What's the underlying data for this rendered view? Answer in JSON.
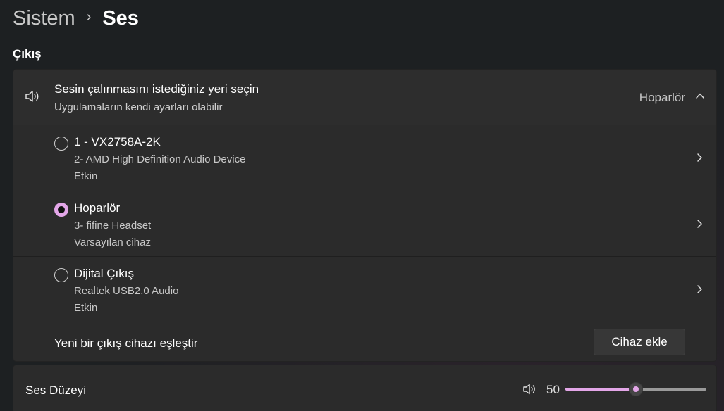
{
  "breadcrumb": {
    "parent": "Sistem",
    "current": "Ses"
  },
  "output_section": {
    "title": "Çıkış",
    "header": {
      "title": "Sesin çalınmasını istediğiniz yeri seçin",
      "subtitle": "Uygulamaların kendi ayarları olabilir",
      "value": "Hoparlör",
      "icon": "speaker-icon",
      "expanded": true
    },
    "devices": [
      {
        "name": "1 - VX2758A-2K",
        "description": "2- AMD High Definition Audio Device",
        "status": "Etkin",
        "selected": false
      },
      {
        "name": "Hoparlör",
        "description": "3- fifine Headset",
        "status": "Varsayılan cihaz",
        "selected": true
      },
      {
        "name": "Dijital Çıkış",
        "description": "Realtek USB2.0 Audio",
        "status": "Etkin",
        "selected": false
      }
    ],
    "pair": {
      "label": "Yeni bir çıkış cihazı eşleştir",
      "button_label": "Cihaz ekle"
    }
  },
  "volume": {
    "label": "Ses Düzeyi",
    "value": "50",
    "level": 0.5,
    "icon": "volume-icon"
  },
  "colors": {
    "accent": "#e3a6e8",
    "background": "#1d2022",
    "card": "#2b2b2b"
  }
}
